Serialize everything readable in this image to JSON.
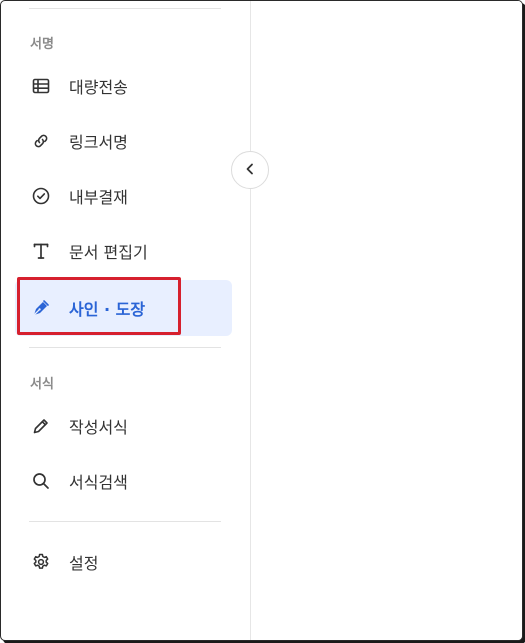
{
  "sections": {
    "signature": "서명",
    "forms": "서식"
  },
  "nav": {
    "bulk_send": "대량전송",
    "link_sign": "링크서명",
    "internal_approval": "내부결재",
    "doc_editor": "문서 편집기",
    "sign_stamp": "사인 · 도장",
    "write_form": "작성서식",
    "search_form": "서식검색",
    "settings": "설정"
  },
  "active_item": "sign_stamp",
  "colors": {
    "active_bg": "#e8efff",
    "active_text": "#2a64d6",
    "highlight": "#d6202e"
  }
}
